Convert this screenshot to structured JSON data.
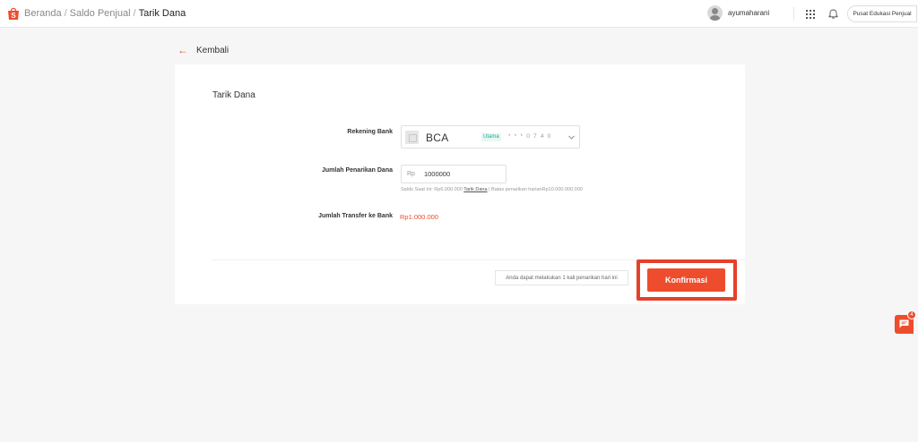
{
  "header": {
    "breadcrumbs": [
      "Beranda",
      "Saldo Penjual",
      "Tarik Dana"
    ],
    "separator": "/",
    "username": "ayumaharani",
    "edu_button": "Pusat Edukasi Penjual"
  },
  "back": {
    "label": "Kembali"
  },
  "form": {
    "title": "Tarik Dana",
    "bank_label": "Rekening Bank",
    "bank_name": "BCA",
    "bank_badge": "Utama",
    "bank_account": "* * * 0 7 4 0",
    "amount_label": "Jumlah Penarikan Dana",
    "amount_prefix": "Rp",
    "amount_value": "1000000",
    "helper_saldo": "Saldo Saat Ini: Rp6.000.000",
    "helper_link": "Tarik Dana",
    "helper_limit": "| Batas penarikan harianRp10.000.000.000",
    "transfer_label": "Jumlah Transfer ke Bank",
    "transfer_value": "Rp1.000.000"
  },
  "footer": {
    "notice": "Anda dapat melakukan 1 kali penarikan hari ini",
    "confirm_label": "Konfirmasi"
  },
  "chat": {
    "badge_count": "4"
  },
  "colors": {
    "accent": "#ee4d2d",
    "highlight": "#e5402a",
    "badge_green": "#26aa99"
  }
}
